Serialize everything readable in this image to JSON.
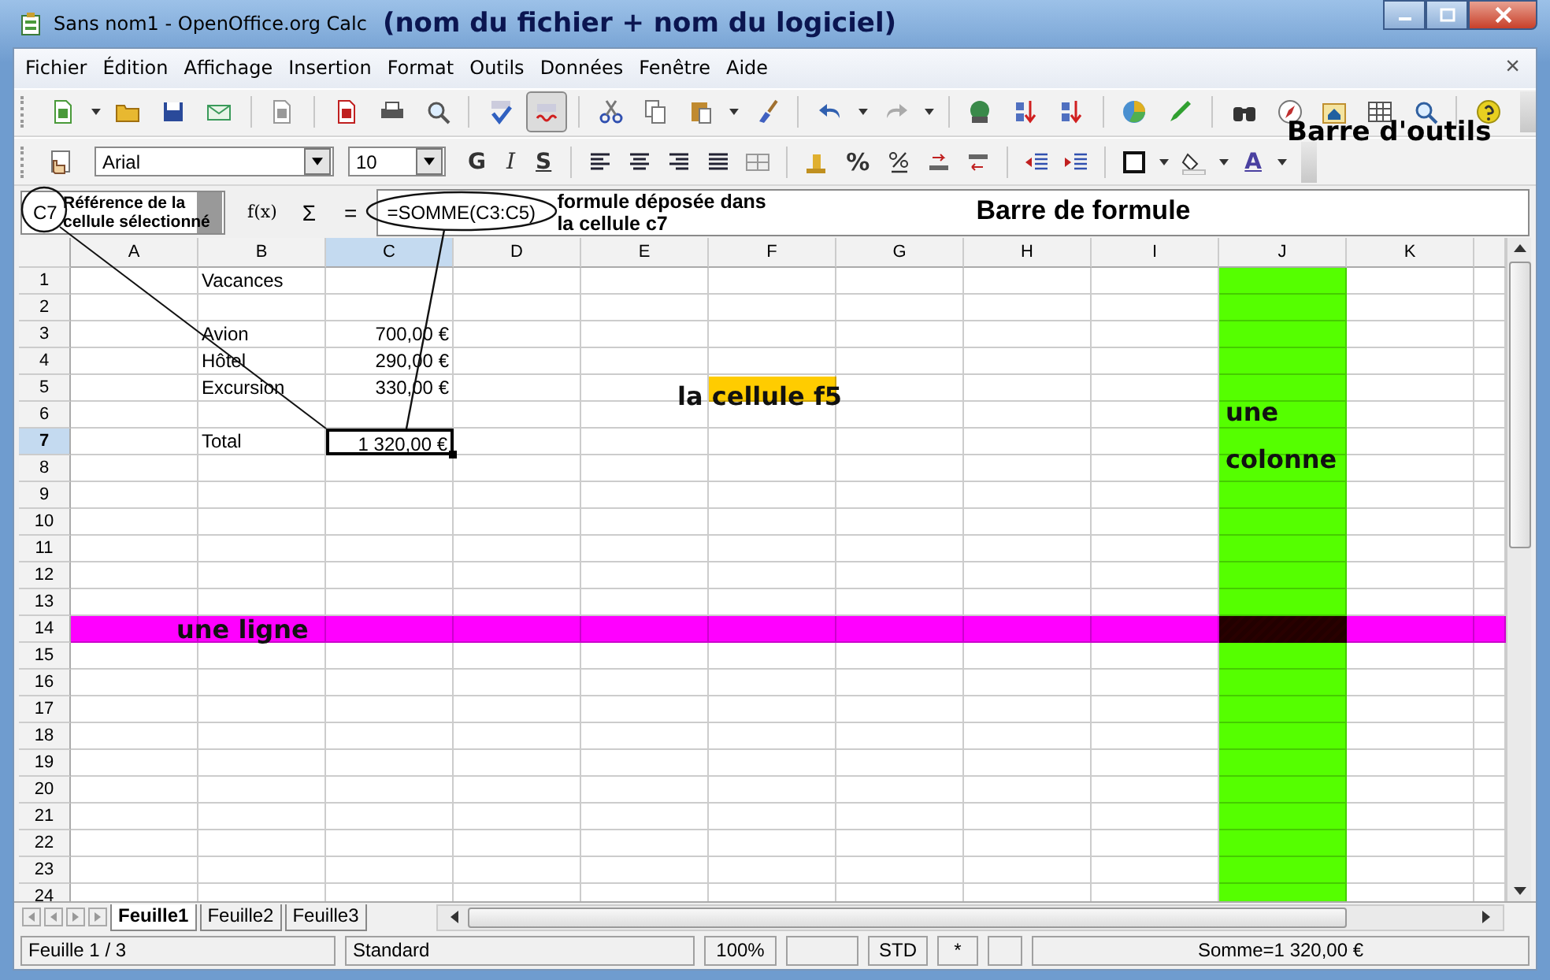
{
  "window": {
    "title": "Sans nom1 - OpenOffice.org Calc"
  },
  "menu": [
    {
      "label": "Fichier"
    },
    {
      "label": "Édition"
    },
    {
      "label": "Affichage"
    },
    {
      "label": "Insertion"
    },
    {
      "label": "Format"
    },
    {
      "label": "Outils"
    },
    {
      "label": "Données"
    },
    {
      "label": "Fenêtre"
    },
    {
      "label": "Aide"
    }
  ],
  "close_document": "×",
  "standard_toolbar": {
    "auto_spellcheck_on": true
  },
  "format_toolbar": {
    "font": "Arial",
    "size": "10",
    "bold": "G",
    "italic": "I",
    "underline": "S",
    "percent": "%",
    "font_color": "A"
  },
  "formula_bar": {
    "cell_reference": "C7",
    "function_wizard": "f(x)",
    "sum": "Σ",
    "equals": "=",
    "formula": "=SOMME(C3:C5)"
  },
  "columns": [
    {
      "label": "A",
      "selected": false
    },
    {
      "label": "B",
      "selected": false
    },
    {
      "label": "C",
      "selected": true
    },
    {
      "label": "D",
      "selected": false
    },
    {
      "label": "E",
      "selected": false
    },
    {
      "label": "F",
      "selected": false
    },
    {
      "label": "G",
      "selected": false
    },
    {
      "label": "H",
      "selected": false
    },
    {
      "label": "I",
      "selected": false
    },
    {
      "label": "J",
      "selected": false
    },
    {
      "label": "K",
      "selected": false
    }
  ],
  "rows": [
    {
      "label": "1",
      "selected": false,
      "b": "Vacances"
    },
    {
      "label": "2",
      "selected": false
    },
    {
      "label": "3",
      "selected": false,
      "b": "Avion",
      "c": "700,00 €"
    },
    {
      "label": "4",
      "selected": false,
      "b": "Hôtel",
      "c": "290,00 €"
    },
    {
      "label": "5",
      "selected": false,
      "b": "Excursion",
      "c": "330,00 €"
    },
    {
      "label": "6",
      "selected": false
    },
    {
      "label": "7",
      "selected": true,
      "b": "Total",
      "c": "1 320,00 €"
    },
    {
      "label": "8",
      "selected": false
    },
    {
      "label": "9",
      "selected": false
    },
    {
      "label": "10",
      "selected": false
    },
    {
      "label": "11",
      "selected": false
    },
    {
      "label": "12",
      "selected": false
    },
    {
      "label": "13",
      "selected": false
    },
    {
      "label": "14",
      "selected": false
    },
    {
      "label": "15",
      "selected": false
    },
    {
      "label": "16",
      "selected": false
    },
    {
      "label": "17",
      "selected": false
    },
    {
      "label": "18",
      "selected": false
    },
    {
      "label": "19",
      "selected": false
    },
    {
      "label": "20",
      "selected": false
    },
    {
      "label": "21",
      "selected": false
    },
    {
      "label": "22",
      "selected": false
    },
    {
      "label": "23",
      "selected": false
    },
    {
      "label": "24",
      "selected": false
    }
  ],
  "sheet_tabs": [
    {
      "label": "Feuille1",
      "selected": true
    },
    {
      "label": "Feuille2",
      "selected": false
    },
    {
      "label": "Feuille3",
      "selected": false
    }
  ],
  "status_bar": {
    "sheet": "Feuille 1 / 3",
    "style": "Standard",
    "zoom": "100%",
    "mode": "STD",
    "modified": "*",
    "sum": "Somme=1 320,00 €"
  },
  "annotations": [
    {
      "kind": "title",
      "text": "(nom du fichier + nom du logiciel)"
    },
    {
      "kind": "toolbar",
      "text": "Barre d'outils"
    },
    {
      "kind": "reference",
      "text": "Référence de la cellule sélectionné"
    },
    {
      "kind": "formula",
      "text": "formule déposée dans la cellule c7"
    },
    {
      "kind": "formula-bar",
      "text": "Barre de formule"
    },
    {
      "kind": "cell",
      "text": "la cellule f5"
    },
    {
      "kind": "column",
      "text": "une colonne"
    },
    {
      "kind": "row",
      "text": "une ligne"
    }
  ]
}
